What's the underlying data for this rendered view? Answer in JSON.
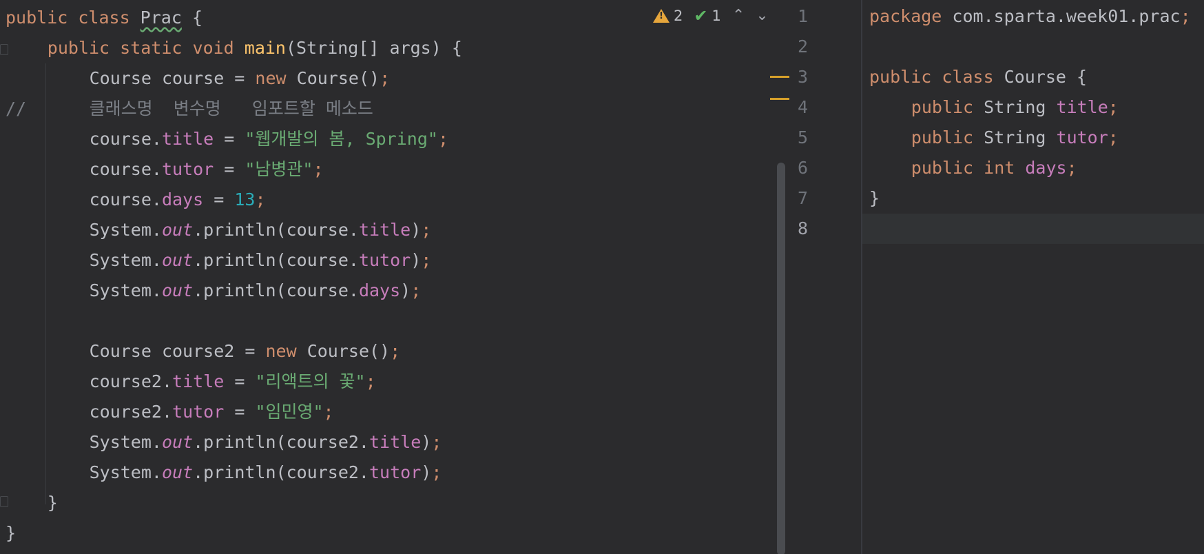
{
  "left_editor": {
    "lines": [
      {
        "indent": 0,
        "tokens": [
          [
            "kw",
            "public class "
          ],
          [
            "cls squiggle",
            "Prac"
          ],
          [
            "punct",
            " {"
          ]
        ]
      },
      {
        "indent": 1,
        "tokens": [
          [
            "kw",
            "public static void "
          ],
          [
            "fn",
            "main"
          ],
          [
            "punct",
            "(String[] args) {"
          ]
        ]
      },
      {
        "indent": 2,
        "tokens": [
          [
            "cls",
            "Course course = "
          ],
          [
            "kw",
            "new "
          ],
          [
            "cls",
            "Course()"
          ],
          [
            "semi",
            ";"
          ]
        ]
      },
      {
        "indent": 0,
        "comment_prefix": "//",
        "tokens": [
          [
            "cmt",
            "클래스명  변수명   임포트할 메소드"
          ]
        ]
      },
      {
        "indent": 2,
        "tokens": [
          [
            "cls",
            "course."
          ],
          [
            "fld",
            "title"
          ],
          [
            "punct",
            " = "
          ],
          [
            "str",
            "\"웹개발의 봄, Spring\""
          ],
          [
            "semi",
            ";"
          ]
        ]
      },
      {
        "indent": 2,
        "tokens": [
          [
            "cls",
            "course."
          ],
          [
            "fld",
            "tutor"
          ],
          [
            "punct",
            " = "
          ],
          [
            "str",
            "\"남병관\""
          ],
          [
            "semi",
            ";"
          ]
        ]
      },
      {
        "indent": 2,
        "tokens": [
          [
            "cls",
            "course."
          ],
          [
            "fld",
            "days"
          ],
          [
            "punct",
            " = "
          ],
          [
            "num",
            "13"
          ],
          [
            "semi",
            ";"
          ]
        ]
      },
      {
        "indent": 2,
        "tokens": [
          [
            "cls",
            "System."
          ],
          [
            "stat",
            "out"
          ],
          [
            "cls",
            ".println(course."
          ],
          [
            "fld",
            "title"
          ],
          [
            "punct",
            ")"
          ],
          [
            "semi",
            ";"
          ]
        ]
      },
      {
        "indent": 2,
        "tokens": [
          [
            "cls",
            "System."
          ],
          [
            "stat",
            "out"
          ],
          [
            "cls",
            ".println(course."
          ],
          [
            "fld",
            "tutor"
          ],
          [
            "punct",
            ")"
          ],
          [
            "semi",
            ";"
          ]
        ]
      },
      {
        "indent": 2,
        "tokens": [
          [
            "cls",
            "System."
          ],
          [
            "stat",
            "out"
          ],
          [
            "cls",
            ".println(course."
          ],
          [
            "fld",
            "days"
          ],
          [
            "punct",
            ")"
          ],
          [
            "semi",
            ";"
          ]
        ]
      },
      {
        "indent": 2,
        "tokens": []
      },
      {
        "indent": 2,
        "tokens": [
          [
            "cls",
            "Course course2 = "
          ],
          [
            "kw",
            "new "
          ],
          [
            "cls",
            "Course()"
          ],
          [
            "semi",
            ";"
          ]
        ]
      },
      {
        "indent": 2,
        "tokens": [
          [
            "cls",
            "course2."
          ],
          [
            "fld",
            "title"
          ],
          [
            "punct",
            " = "
          ],
          [
            "str",
            "\"리액트의 꽃\""
          ],
          [
            "semi",
            ";"
          ]
        ]
      },
      {
        "indent": 2,
        "tokens": [
          [
            "cls",
            "course2."
          ],
          [
            "fld",
            "tutor"
          ],
          [
            "punct",
            " = "
          ],
          [
            "str",
            "\"임민영\""
          ],
          [
            "semi",
            ";"
          ]
        ]
      },
      {
        "indent": 2,
        "tokens": [
          [
            "cls",
            "System."
          ],
          [
            "stat",
            "out"
          ],
          [
            "cls",
            ".println(course2."
          ],
          [
            "fld",
            "title"
          ],
          [
            "punct",
            ")"
          ],
          [
            "semi",
            ";"
          ]
        ]
      },
      {
        "indent": 2,
        "tokens": [
          [
            "cls",
            "System."
          ],
          [
            "stat",
            "out"
          ],
          [
            "cls",
            ".println(course2."
          ],
          [
            "fld",
            "tutor"
          ],
          [
            "punct",
            ")"
          ],
          [
            "semi",
            ";"
          ]
        ]
      },
      {
        "indent": 1,
        "tokens": [
          [
            "punct",
            "}"
          ]
        ]
      },
      {
        "indent": 0,
        "tokens": [
          [
            "punct",
            "}"
          ]
        ]
      }
    ]
  },
  "inspections": {
    "warnings_count": "2",
    "ok_count": "1",
    "warning_icon": "warning-triangle-icon",
    "ok_icon": "check-icon",
    "prev_icon": "chevron-up-icon",
    "next_icon": "chevron-down-icon"
  },
  "right_editor": {
    "line_numbers": [
      "1",
      "2",
      "3",
      "4",
      "5",
      "6",
      "7",
      "8"
    ],
    "current_line": "8",
    "lines": [
      {
        "indent": 0,
        "tokens": [
          [
            "kw",
            "package "
          ],
          [
            "cls",
            "com.sparta.week01.prac"
          ],
          [
            "semi",
            ";"
          ]
        ]
      },
      {
        "indent": 0,
        "tokens": []
      },
      {
        "indent": 0,
        "tokens": [
          [
            "kw",
            "public class "
          ],
          [
            "cls",
            "Course {"
          ]
        ]
      },
      {
        "indent": 1,
        "tokens": [
          [
            "kw",
            "public "
          ],
          [
            "cls",
            "String "
          ],
          [
            "fld",
            "title"
          ],
          [
            "semi",
            ";"
          ]
        ]
      },
      {
        "indent": 1,
        "tokens": [
          [
            "kw",
            "public "
          ],
          [
            "cls",
            "String "
          ],
          [
            "fld",
            "tutor"
          ],
          [
            "semi",
            ";"
          ]
        ]
      },
      {
        "indent": 1,
        "tokens": [
          [
            "kw",
            "public int "
          ],
          [
            "fld",
            "days"
          ],
          [
            "semi",
            ";"
          ]
        ]
      },
      {
        "indent": 0,
        "tokens": [
          [
            "punct",
            "}"
          ]
        ]
      },
      {
        "indent": 0,
        "tokens": []
      }
    ]
  },
  "colors": {
    "background": "#2b2b2d",
    "keyword": "#cf8e6d",
    "field": "#c77dbb",
    "string": "#6aab73",
    "number": "#2aacb8",
    "function": "#ffc66d",
    "comment": "#7a7e85"
  }
}
